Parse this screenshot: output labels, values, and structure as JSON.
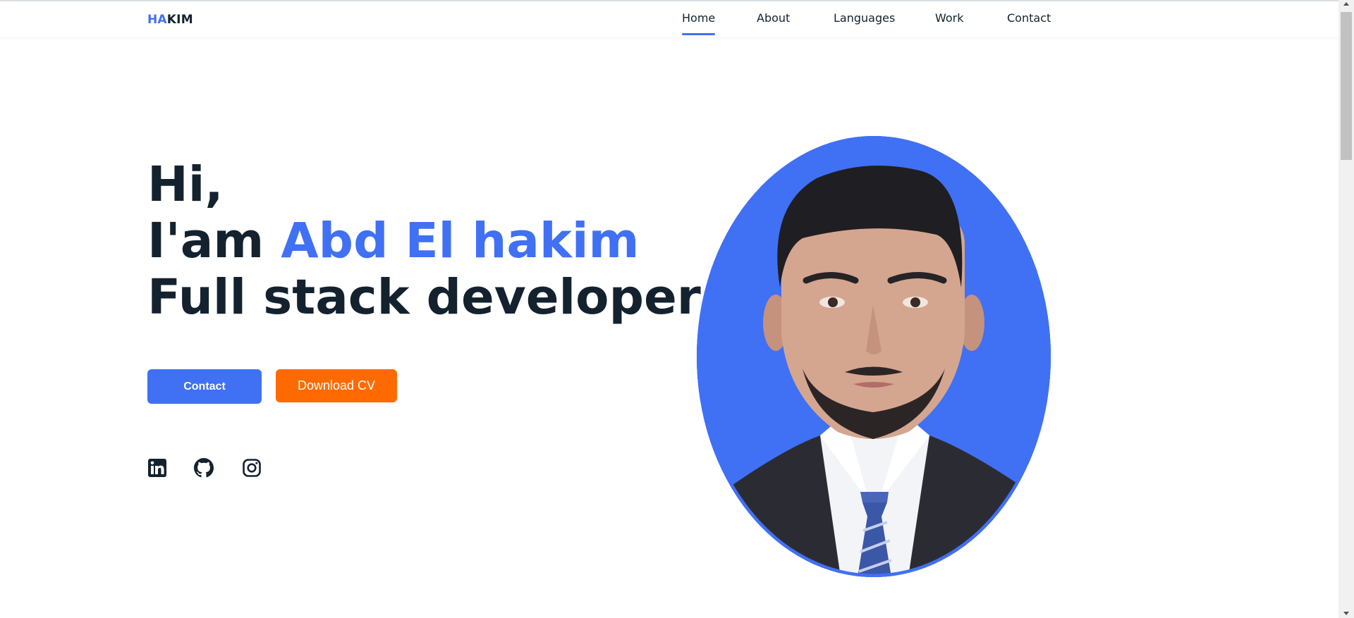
{
  "logo": {
    "part1": "HA",
    "part2": "KIM"
  },
  "nav": {
    "items": [
      {
        "label": "Home",
        "active": true
      },
      {
        "label": "About",
        "active": false
      },
      {
        "label": "Languages",
        "active": false
      },
      {
        "label": "Work",
        "active": false
      },
      {
        "label": "Contact",
        "active": false
      }
    ]
  },
  "hero": {
    "greeting": "Hi,",
    "intro_prefix": "I'am ",
    "name": "Abd El hakim",
    "role": "Full stack developer",
    "buttons": {
      "contact": "Contact",
      "download_cv": "Download CV"
    },
    "socials": [
      "linkedin-icon",
      "github-icon",
      "instagram-icon"
    ]
  },
  "colors": {
    "accent": "#4070f4",
    "cta": "#ff6a00",
    "text": "#13222e"
  }
}
